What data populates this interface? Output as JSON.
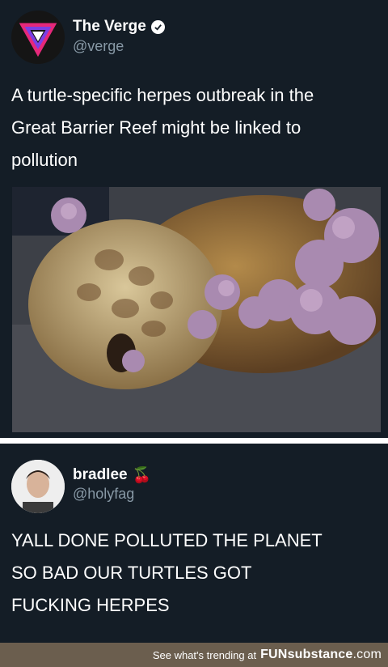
{
  "tweets": [
    {
      "name": "The Verge",
      "handle": "@verge",
      "verified": true,
      "avatar_icon": "verge-logo-icon",
      "lines": [
        "A turtle-specific herpes outbreak in the",
        "Great Barrier Reef might be linked to",
        "pollution"
      ],
      "image": "turtle-photo"
    },
    {
      "name": "bradlee",
      "handle": "@holyfag",
      "name_emoji": "🍒",
      "avatar_icon": "user-avatar",
      "lines": [
        "YALL DONE POLLUTED THE PLANET",
        "SO BAD OUR TURTLES GOT",
        "FUCKING HERPES"
      ]
    }
  ],
  "footer": {
    "text": "See what's trending at",
    "brand_bold": "FUN",
    "brand_rest": "substance",
    "brand_suffix": ".com"
  },
  "colors": {
    "background": "#141d26",
    "handle": "#8899a6",
    "footer": "#6b5e4e"
  }
}
